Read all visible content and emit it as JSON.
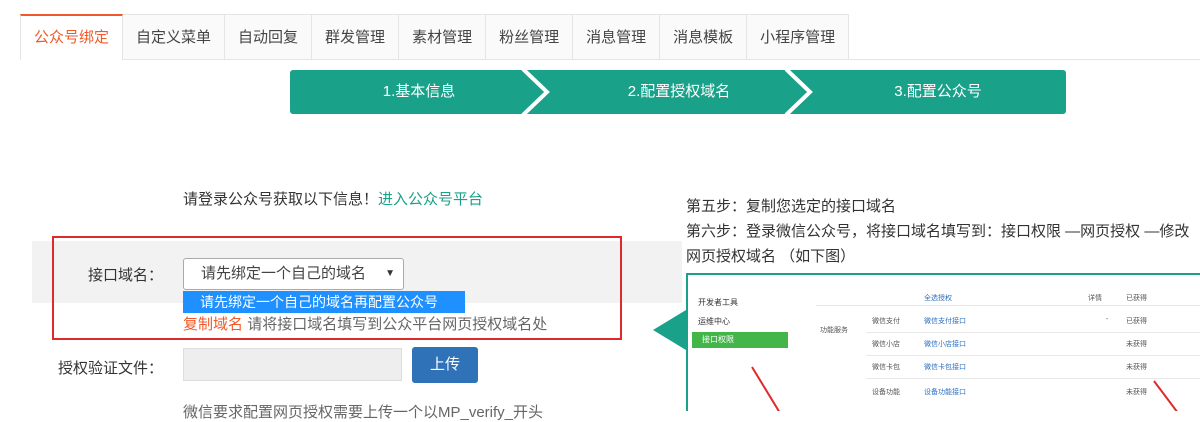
{
  "tabs": [
    "公众号绑定",
    "自定义菜单",
    "自动回复",
    "群发管理",
    "素材管理",
    "粉丝管理",
    "消息管理",
    "消息模板",
    "小程序管理"
  ],
  "steps": [
    "1.基本信息",
    "2.配置授权域名",
    "3.配置公众号"
  ],
  "intro": {
    "text": "请登录公众号获取以下信息！",
    "link": "进入公众号平台"
  },
  "domain": {
    "label": "接口域名：",
    "select_value": "请先绑定一个自己的域名",
    "option": "请先绑定一个自己的域名再配置公众号",
    "copy_link": "复制域名",
    "copy_hint": "请将接口域名填写到公众平台网页授权域名处"
  },
  "verify": {
    "label": "授权验证文件：",
    "upload": "上传",
    "note": "微信要求配置网页授权需要上传一个以MP_verify_开头"
  },
  "instructions": {
    "step5": "第五步：复制您选定的接口域名",
    "step6_line1": "第六步：登录微信公众号，将接口域名填写到：接口权限 —网页授权 —修改",
    "step6_line2": "网页授权域名 （如下图）"
  },
  "screenshot": {
    "menu": [
      "开发者工具",
      "运维中心",
      "接口权限"
    ],
    "section": "功能服务",
    "header_link": "全选授权",
    "header_detail": "详情",
    "header_status": "已获得",
    "rows": [
      {
        "name": "微信支付",
        "link": "微信支付接口",
        "value": "-",
        "status": "已获得"
      },
      {
        "name": "微信小店",
        "link": "微信小店接口",
        "value": "",
        "status": "未获得"
      },
      {
        "name": "微信卡包",
        "link": "微信卡包接口",
        "value": "",
        "status": "未获得"
      },
      {
        "name": "设备功能",
        "link": "设备功能接口",
        "value": "",
        "status": "未获得"
      }
    ]
  },
  "colors": {
    "accent": "#f05a28",
    "teal": "#1aa18a",
    "red_box": "#e02a2a",
    "upload": "#2f72b8",
    "option_bg": "#1e90ff"
  }
}
